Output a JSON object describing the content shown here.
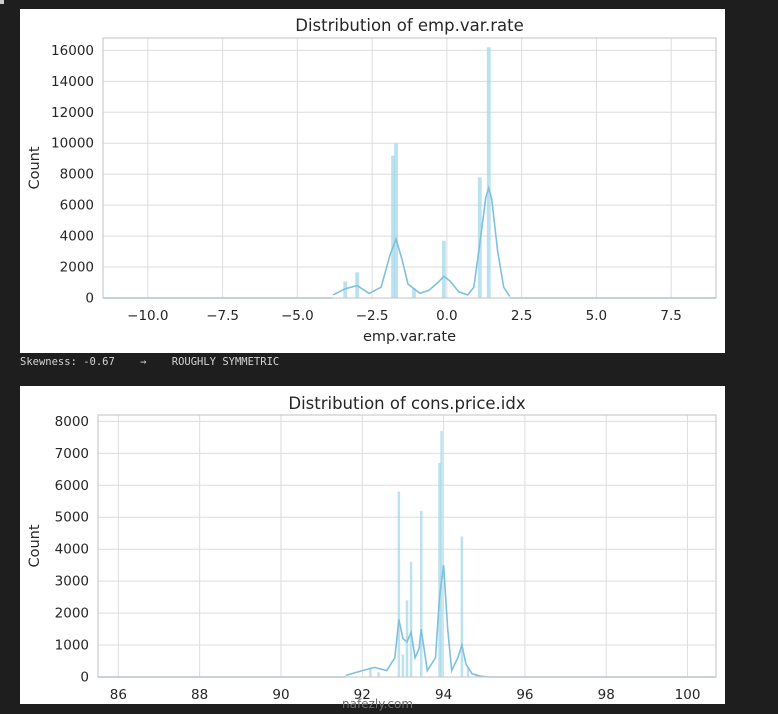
{
  "output_text": {
    "skewness_label": "Skewness: -0.67",
    "arrow": "→",
    "verdict": "ROUGHLY SYMMETRIC"
  },
  "watermark": "nafezly.com",
  "colors": {
    "bar": "#a6d8ea",
    "kde": "#7ec1dd",
    "grid": "#dddddd",
    "frame": "#cccccc",
    "text": "#262626"
  },
  "chart_data": [
    {
      "type": "bar",
      "title": "Distribution of emp.var.rate",
      "xlabel": "emp.var.rate",
      "ylabel": "Count",
      "xlim": [
        -11.5,
        9.0
      ],
      "ylim": [
        0,
        16800
      ],
      "xticks": [
        -10.0,
        -7.5,
        -5.0,
        -2.5,
        0.0,
        2.5,
        5.0,
        7.5
      ],
      "xtick_labels": [
        "−10.0",
        "−7.5",
        "−5.0",
        "−2.5",
        "0.0",
        "2.5",
        "5.0",
        "7.5"
      ],
      "yticks": [
        0,
        2000,
        4000,
        6000,
        8000,
        10000,
        12000,
        14000,
        16000
      ],
      "ytick_labels": [
        "0",
        "2000",
        "4000",
        "6000",
        "8000",
        "10000",
        "12000",
        "14000",
        "16000"
      ],
      "grid": true,
      "bin_width": 0.13,
      "bars": [
        {
          "x": -3.4,
          "count": 1070
        },
        {
          "x": -3.0,
          "count": 1660
        },
        {
          "x": -1.8,
          "count": 9200
        },
        {
          "x": -1.7,
          "count": 10000
        },
        {
          "x": -1.1,
          "count": 630
        },
        {
          "x": -0.1,
          "count": 3700
        },
        {
          "x": 1.1,
          "count": 7800
        },
        {
          "x": 1.4,
          "count": 16200
        }
      ],
      "kde": {
        "x": [
          -3.8,
          -3.4,
          -3.0,
          -2.6,
          -2.2,
          -1.9,
          -1.7,
          -1.5,
          -1.3,
          -1.1,
          -0.9,
          -0.6,
          -0.3,
          -0.1,
          0.1,
          0.4,
          0.7,
          0.9,
          1.1,
          1.3,
          1.4,
          1.5,
          1.7,
          1.9,
          2.1
        ],
        "y": [
          200,
          600,
          800,
          300,
          700,
          2800,
          3800,
          2500,
          900,
          600,
          300,
          500,
          1000,
          1400,
          1100,
          400,
          200,
          700,
          3500,
          6500,
          7100,
          6400,
          3000,
          700,
          100
        ]
      }
    },
    {
      "type": "bar",
      "title": "Distribution of cons.price.idx",
      "xlabel": "",
      "ylabel": "Count",
      "xlim": [
        85.5,
        100.7
      ],
      "ylim": [
        0,
        8200
      ],
      "xticks": [
        86,
        88,
        90,
        92,
        94,
        96,
        98,
        100
      ],
      "xtick_labels": [
        "86",
        "88",
        "90",
        "92",
        "94",
        "96",
        "98",
        "100"
      ],
      "yticks": [
        0,
        1000,
        2000,
        3000,
        4000,
        5000,
        6000,
        7000,
        8000
      ],
      "ytick_labels": [
        "0",
        "1000",
        "2000",
        "3000",
        "4000",
        "5000",
        "6000",
        "7000",
        "8000"
      ],
      "grid": true,
      "bin_width": 0.05,
      "bars": [
        {
          "x": 92.2,
          "count": 300
        },
        {
          "x": 92.4,
          "count": 150
        },
        {
          "x": 92.9,
          "count": 5800
        },
        {
          "x": 93.0,
          "count": 700
        },
        {
          "x": 93.1,
          "count": 2400
        },
        {
          "x": 93.2,
          "count": 3600
        },
        {
          "x": 93.45,
          "count": 5200
        },
        {
          "x": 93.9,
          "count": 6700
        },
        {
          "x": 93.95,
          "count": 7700
        },
        {
          "x": 94.45,
          "count": 4400
        },
        {
          "x": 94.6,
          "count": 300
        },
        {
          "x": 94.8,
          "count": 100
        }
      ],
      "kde": {
        "x": [
          91.6,
          92.0,
          92.3,
          92.6,
          92.8,
          92.9,
          93.0,
          93.1,
          93.2,
          93.3,
          93.4,
          93.45,
          93.6,
          93.8,
          93.9,
          94.0,
          94.1,
          94.2,
          94.35,
          94.45,
          94.55,
          94.7,
          94.9,
          95.1
        ],
        "y": [
          50,
          200,
          300,
          200,
          600,
          1800,
          1200,
          1100,
          1400,
          600,
          900,
          1500,
          200,
          600,
          2500,
          3500,
          1500,
          200,
          600,
          1000,
          400,
          100,
          30,
          0
        ]
      }
    }
  ]
}
